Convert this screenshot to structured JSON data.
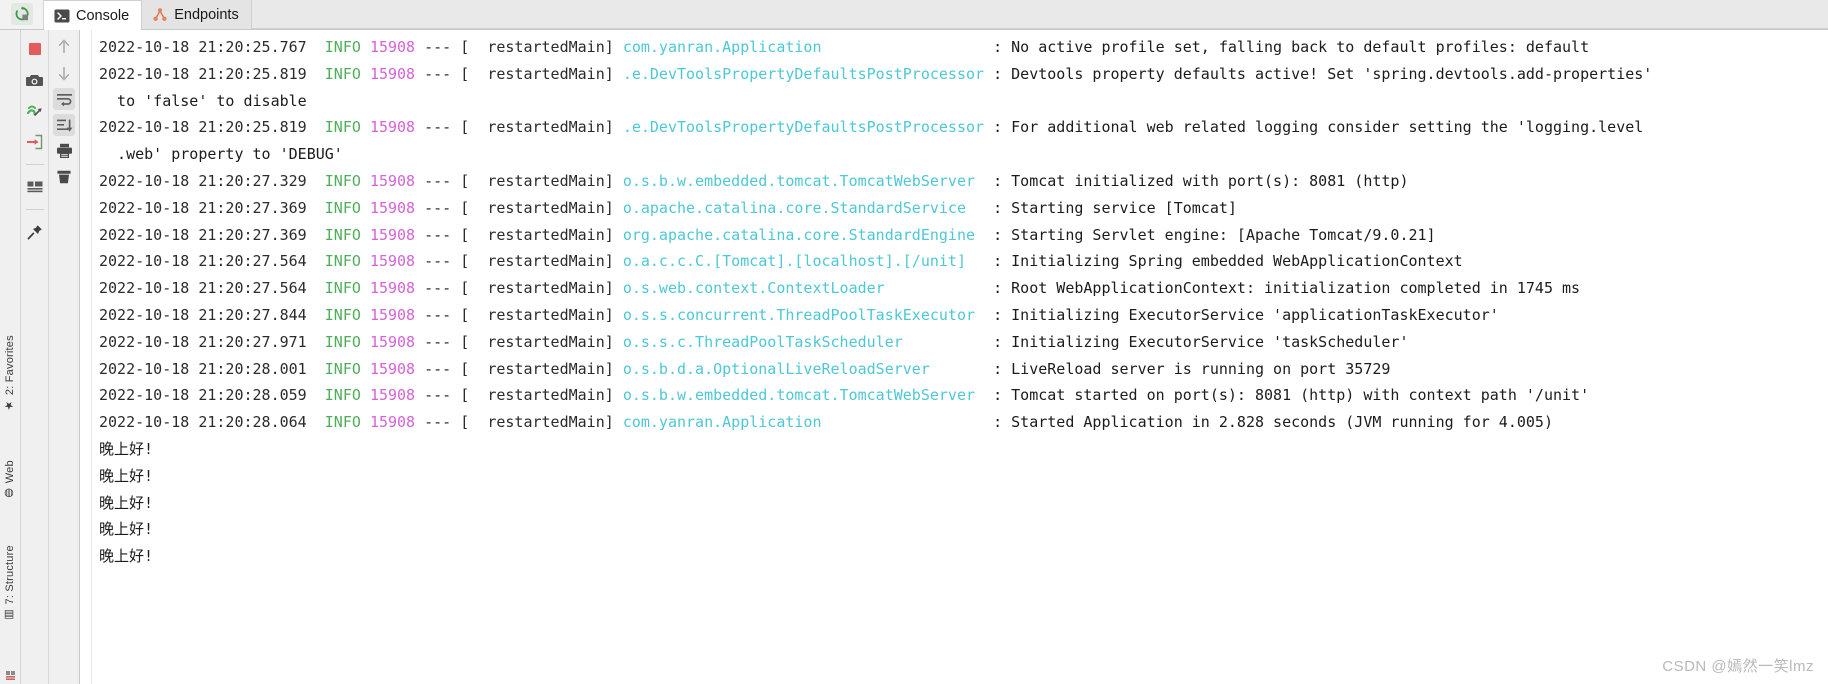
{
  "window": {
    "rerun_icon": "rerun-icon"
  },
  "tabs": [
    {
      "label": "Console",
      "icon": "console-icon",
      "active": true
    },
    {
      "label": "Endpoints",
      "icon": "endpoints-icon",
      "active": false
    }
  ],
  "left_toolbar": [
    {
      "name": "stop-button",
      "icon": "stop-icon"
    },
    {
      "name": "screenshot-button",
      "icon": "camera-icon"
    },
    {
      "name": "thread-dump-button",
      "icon": "thread-dump-icon"
    },
    {
      "name": "export-button",
      "icon": "export-icon"
    },
    {
      "name": "console-layout-button",
      "icon": "layout-icon"
    },
    {
      "name": "pin-tab-button",
      "icon": "pin-icon"
    }
  ],
  "console_toolbar": [
    {
      "name": "scroll-up-button",
      "icon": "arrow-up-icon",
      "selected": false
    },
    {
      "name": "scroll-down-button",
      "icon": "arrow-down-icon",
      "selected": false
    },
    {
      "name": "soft-wrap-button",
      "icon": "soft-wrap-icon",
      "selected": true
    },
    {
      "name": "scroll-to-end-button",
      "icon": "scroll-to-end-icon",
      "selected": true
    },
    {
      "name": "print-button",
      "icon": "print-icon",
      "selected": false
    },
    {
      "name": "clear-all-button",
      "icon": "trash-icon",
      "selected": false
    }
  ],
  "tool_windows": [
    {
      "label": "2: Favorites",
      "icon": "star-icon"
    },
    {
      "label": "Web",
      "icon": "web-icon"
    },
    {
      "label": "7: Structure",
      "icon": "structure-icon"
    }
  ],
  "colors": {
    "level_info": "#4fae5a",
    "pid": "#d663d6",
    "logger": "#4ec8d4",
    "text": "#1c1c1c",
    "tab_active_bg": "#ffffff",
    "panel_bg": "#f0f0f0"
  },
  "console_log": [
    {
      "type": "entry",
      "timestamp": "2022-10-18 21:20:25.767",
      "level": "INFO",
      "pid": "15908",
      "sep": "---",
      "thread": "[  restartedMain]",
      "logger": "com.yanran.Application",
      "message": ": No active profile set, falling back to default profiles: default"
    },
    {
      "type": "entry",
      "timestamp": "2022-10-18 21:20:25.819",
      "level": "INFO",
      "pid": "15908",
      "sep": "---",
      "thread": "[  restartedMain]",
      "logger": ".e.DevToolsPropertyDefaultsPostProcessor",
      "message": ": Devtools property defaults active! Set 'spring.devtools.add-properties'"
    },
    {
      "type": "wrap",
      "text": "  to 'false' to disable"
    },
    {
      "type": "entry",
      "timestamp": "2022-10-18 21:20:25.819",
      "level": "INFO",
      "pid": "15908",
      "sep": "---",
      "thread": "[  restartedMain]",
      "logger": ".e.DevToolsPropertyDefaultsPostProcessor",
      "message": ": For additional web related logging consider setting the 'logging.level"
    },
    {
      "type": "wrap",
      "text": "  .web' property to 'DEBUG'"
    },
    {
      "type": "entry",
      "timestamp": "2022-10-18 21:20:27.329",
      "level": "INFO",
      "pid": "15908",
      "sep": "---",
      "thread": "[  restartedMain]",
      "logger": "o.s.b.w.embedded.tomcat.TomcatWebServer",
      "message": ": Tomcat initialized with port(s): 8081 (http)"
    },
    {
      "type": "entry",
      "timestamp": "2022-10-18 21:20:27.369",
      "level": "INFO",
      "pid": "15908",
      "sep": "---",
      "thread": "[  restartedMain]",
      "logger": "o.apache.catalina.core.StandardService",
      "message": ": Starting service [Tomcat]"
    },
    {
      "type": "entry",
      "timestamp": "2022-10-18 21:20:27.369",
      "level": "INFO",
      "pid": "15908",
      "sep": "---",
      "thread": "[  restartedMain]",
      "logger": "org.apache.catalina.core.StandardEngine",
      "message": ": Starting Servlet engine: [Apache Tomcat/9.0.21]"
    },
    {
      "type": "entry",
      "timestamp": "2022-10-18 21:20:27.564",
      "level": "INFO",
      "pid": "15908",
      "sep": "---",
      "thread": "[  restartedMain]",
      "logger": "o.a.c.c.C.[Tomcat].[localhost].[/unit]",
      "message": ": Initializing Spring embedded WebApplicationContext"
    },
    {
      "type": "entry",
      "timestamp": "2022-10-18 21:20:27.564",
      "level": "INFO",
      "pid": "15908",
      "sep": "---",
      "thread": "[  restartedMain]",
      "logger": "o.s.web.context.ContextLoader",
      "message": ": Root WebApplicationContext: initialization completed in 1745 ms"
    },
    {
      "type": "entry",
      "timestamp": "2022-10-18 21:20:27.844",
      "level": "INFO",
      "pid": "15908",
      "sep": "---",
      "thread": "[  restartedMain]",
      "logger": "o.s.s.concurrent.ThreadPoolTaskExecutor",
      "message": ": Initializing ExecutorService 'applicationTaskExecutor'"
    },
    {
      "type": "entry",
      "timestamp": "2022-10-18 21:20:27.971",
      "level": "INFO",
      "pid": "15908",
      "sep": "---",
      "thread": "[  restartedMain]",
      "logger": "o.s.s.c.ThreadPoolTaskScheduler",
      "message": ": Initializing ExecutorService 'taskScheduler'"
    },
    {
      "type": "entry",
      "timestamp": "2022-10-18 21:20:28.001",
      "level": "INFO",
      "pid": "15908",
      "sep": "---",
      "thread": "[  restartedMain]",
      "logger": "o.s.b.d.a.OptionalLiveReloadServer",
      "message": ": LiveReload server is running on port 35729"
    },
    {
      "type": "entry",
      "timestamp": "2022-10-18 21:20:28.059",
      "level": "INFO",
      "pid": "15908",
      "sep": "---",
      "thread": "[  restartedMain]",
      "logger": "o.s.b.w.embedded.tomcat.TomcatWebServer",
      "message": ": Tomcat started on port(s): 8081 (http) with context path '/unit'"
    },
    {
      "type": "entry",
      "timestamp": "2022-10-18 21:20:28.064",
      "level": "INFO",
      "pid": "15908",
      "sep": "---",
      "thread": "[  restartedMain]",
      "logger": "com.yanran.Application",
      "message": ": Started Application in 2.828 seconds (JVM running for 4.005)"
    },
    {
      "type": "plain",
      "text": "晚上好!"
    },
    {
      "type": "plain",
      "text": "晚上好!"
    },
    {
      "type": "plain",
      "text": "晚上好!"
    },
    {
      "type": "plain",
      "text": "晚上好!"
    },
    {
      "type": "plain",
      "text": "晚上好!"
    }
  ],
  "watermark": "CSDN @嫣然一笑lmz"
}
